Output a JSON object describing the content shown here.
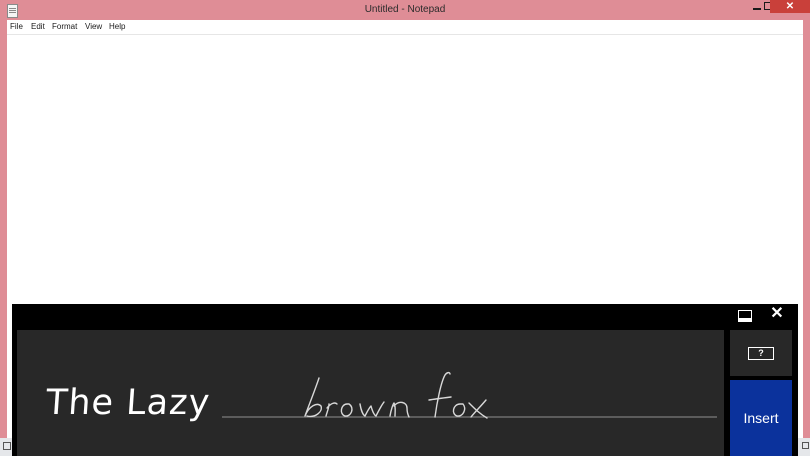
{
  "window": {
    "title": "Untitled - Notepad",
    "close_glyph": "✕",
    "accent_color": "#df8d96"
  },
  "menu": {
    "items": [
      "File",
      "Edit",
      "Format",
      "View",
      "Help"
    ]
  },
  "handwriting_panel": {
    "recognized_text": "The Lazy",
    "ink_text": "brown fox",
    "close_glyph": "✕",
    "help_label": "?",
    "insert_label": "Insert",
    "insert_color": "#0b329c"
  }
}
